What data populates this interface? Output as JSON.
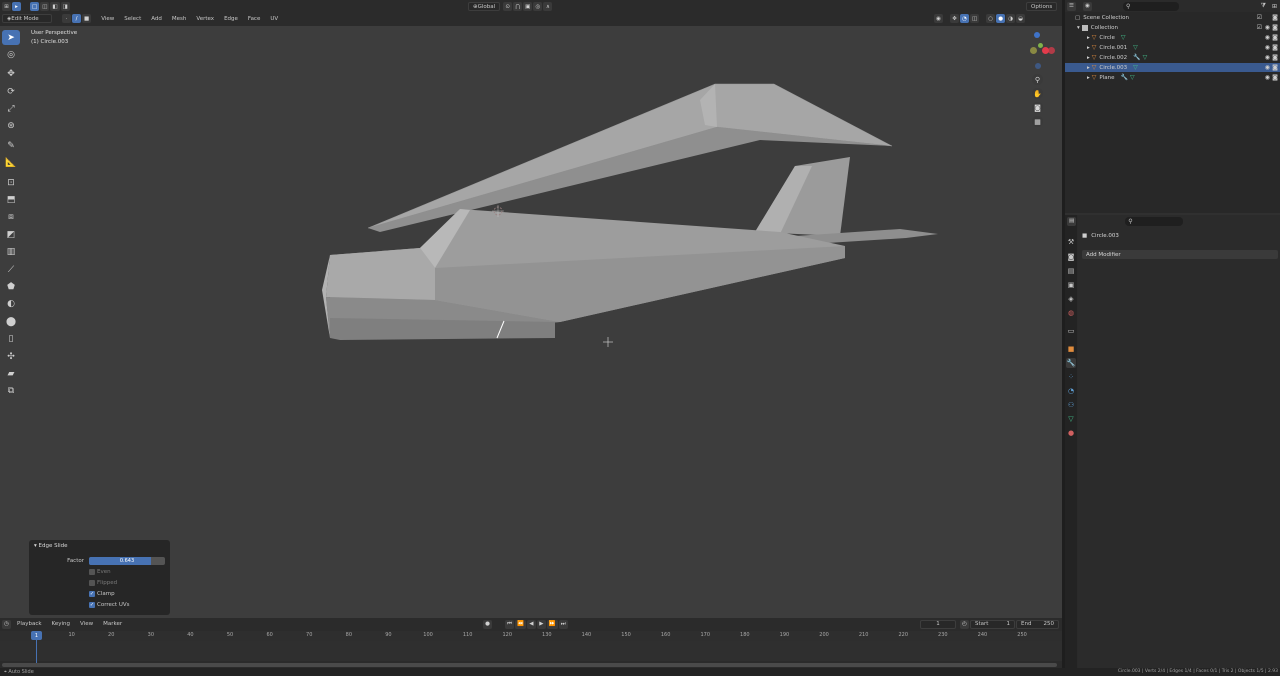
{
  "header": {
    "mode": "Edit Mode",
    "menus": [
      "View",
      "Select",
      "Add",
      "Mesh",
      "Vertex",
      "Edge",
      "Face",
      "UV"
    ],
    "orientation": "Global",
    "options": "Options"
  },
  "viewport": {
    "perspective": "User Perspective",
    "object": "(1) Circle.003"
  },
  "edge_slide": {
    "title": "Edge Slide",
    "factor_label": "Factor",
    "factor_value": "0.643",
    "even_label": "Even",
    "flipped_label": "Flipped",
    "clamp_label": "Clamp",
    "correct_uvs_label": "Correct UVs",
    "check": "✓"
  },
  "timeline": {
    "menus": [
      "Playback",
      "Keying",
      "View",
      "Marker"
    ],
    "current_frame": "1",
    "start_label": "Start",
    "start_value": "1",
    "end_label": "End",
    "end_value": "250",
    "ticks": [
      "1",
      "10",
      "20",
      "30",
      "40",
      "50",
      "60",
      "70",
      "80",
      "90",
      "100",
      "110",
      "120",
      "130",
      "140",
      "150",
      "160",
      "170",
      "180",
      "190",
      "200",
      "210",
      "220",
      "230",
      "240",
      "250"
    ]
  },
  "outliner": {
    "scene_collection": "Scene Collection",
    "collection": "Collection",
    "items": [
      "Circle",
      "Circle.001",
      "Circle.002",
      "Circle.003",
      "Plane"
    ]
  },
  "properties": {
    "object_name": "Circle.003",
    "add_modifier": "Add Modifier"
  },
  "status": {
    "left": "Auto Slide",
    "right": "Circle.003 | Verts 2/4 | Edges 1/4 | Faces 0/1 | Tris 2 | Objects 1/5 | 2.93"
  },
  "colors": {
    "accent": "#4772b3",
    "outliner_selected": "#3a5a8f",
    "object_icon": "#e08c3d",
    "modifier_icon": "#43c48e"
  }
}
